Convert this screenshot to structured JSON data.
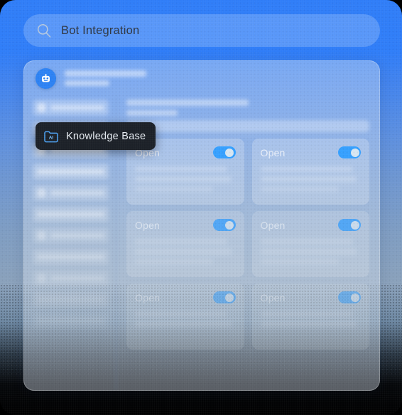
{
  "search": {
    "value": "Bot Integration",
    "icon": "search-icon"
  },
  "panel": {
    "avatar_icon": "robot-icon"
  },
  "tooltip": {
    "label": "Knowledge Base",
    "icon": "ai-folder-icon"
  },
  "cards": [
    {
      "label": "Open",
      "toggle_on": true
    },
    {
      "label": "Open",
      "toggle_on": true
    },
    {
      "label": "Open",
      "toggle_on": true
    },
    {
      "label": "Open",
      "toggle_on": true
    },
    {
      "label": "Open",
      "toggle_on": true
    },
    {
      "label": "Open",
      "toggle_on": true
    }
  ],
  "colors": {
    "background_top": "#2f7df8",
    "background_bottom": "#000000",
    "accent": "#35a0ff",
    "avatar": "#2c82f4",
    "tooltip_bg": "#1b2027",
    "tooltip_text": "#e8edf3",
    "search_text": "#2e3641"
  }
}
